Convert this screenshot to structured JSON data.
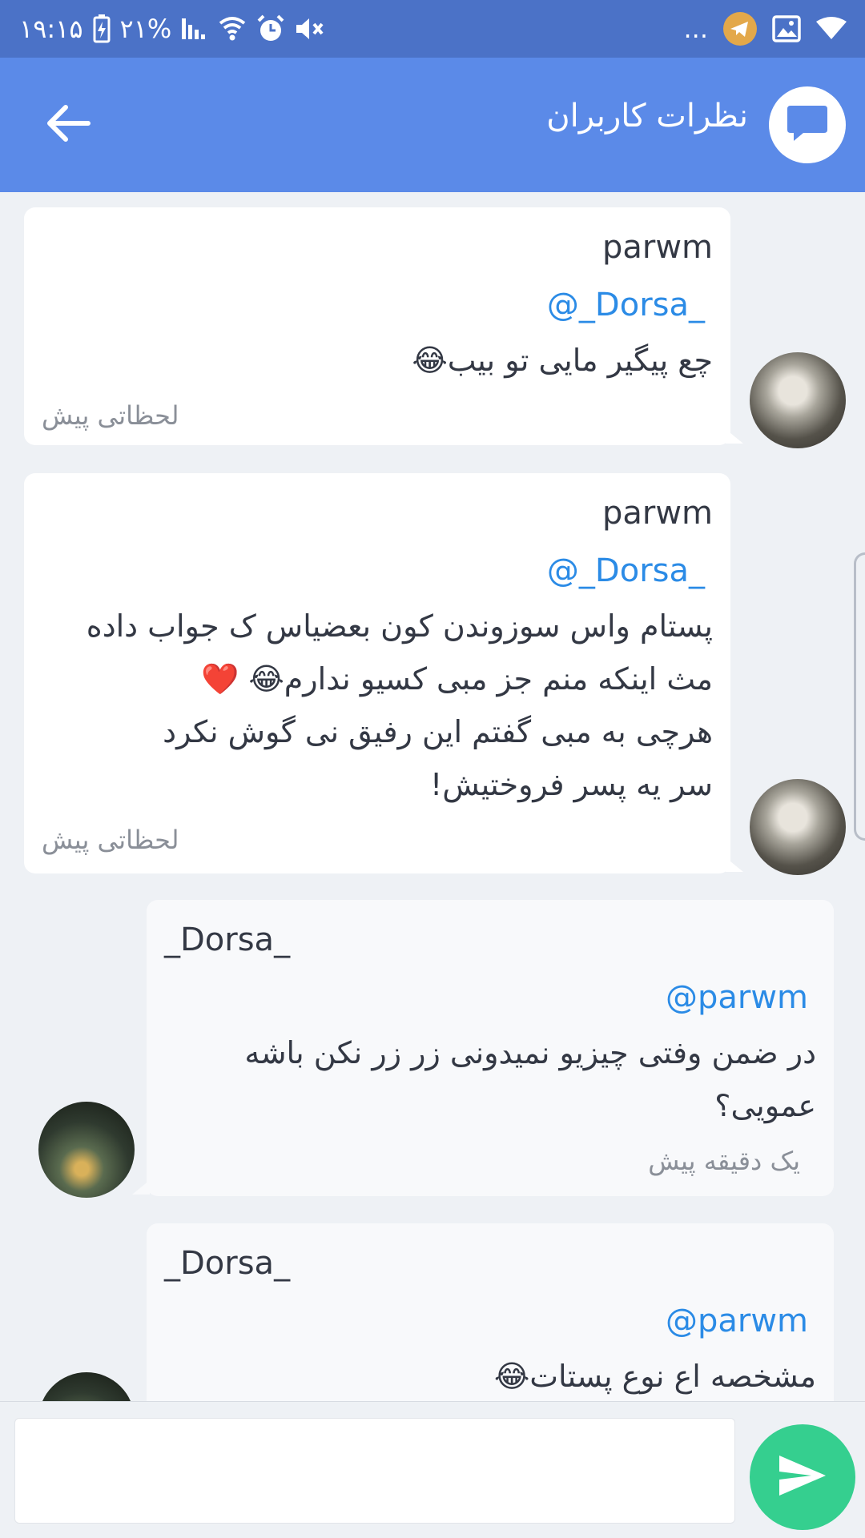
{
  "status_bar": {
    "time": "۱۹:۱۵",
    "battery": "۲۱%",
    "more": "..."
  },
  "app_bar": {
    "title": "نظرات کاربران",
    "back_icon": "arrow-back-icon",
    "logo_icon": "chat-bubble-icon"
  },
  "comments": [
    {
      "username": "parwm",
      "mention": "@_Dorsa_",
      "lines": [
        "چع پیگیر مایی تو بیب😂"
      ],
      "time": "لحظاتی پیش"
    },
    {
      "username": "parwm",
      "mention": "@_Dorsa_",
      "lines": [
        "پستام واس سوزوندن کون بعضیاس ک جواب داده",
        "مث اینکه منم جز مبی کسیو ندارم😂 ❤️",
        "هرچی به مبی گفتم این رفیق نی گوش نکرد",
        "سر یه پسر فروختیش!"
      ],
      "time": "لحظاتی پیش"
    },
    {
      "username": "_Dorsa_",
      "mention": "@parwm",
      "lines": [
        "در ضمن وفتی چیزیو نمیدونی زر زر نکن باشه",
        "عمویی؟"
      ],
      "time": "یک دقیقه پیش"
    },
    {
      "username": "_Dorsa_",
      "mention": "@parwm",
      "lines": [
        "مشخصه اع نوع پستات😂"
      ],
      "time": ""
    }
  ],
  "composer": {
    "placeholder": "",
    "send_icon": "send-icon"
  },
  "colors": {
    "status_bar": "#4b72c7",
    "app_bar": "#5b8ae8",
    "mention": "#2b8be6",
    "send_button": "#35cf8f"
  }
}
